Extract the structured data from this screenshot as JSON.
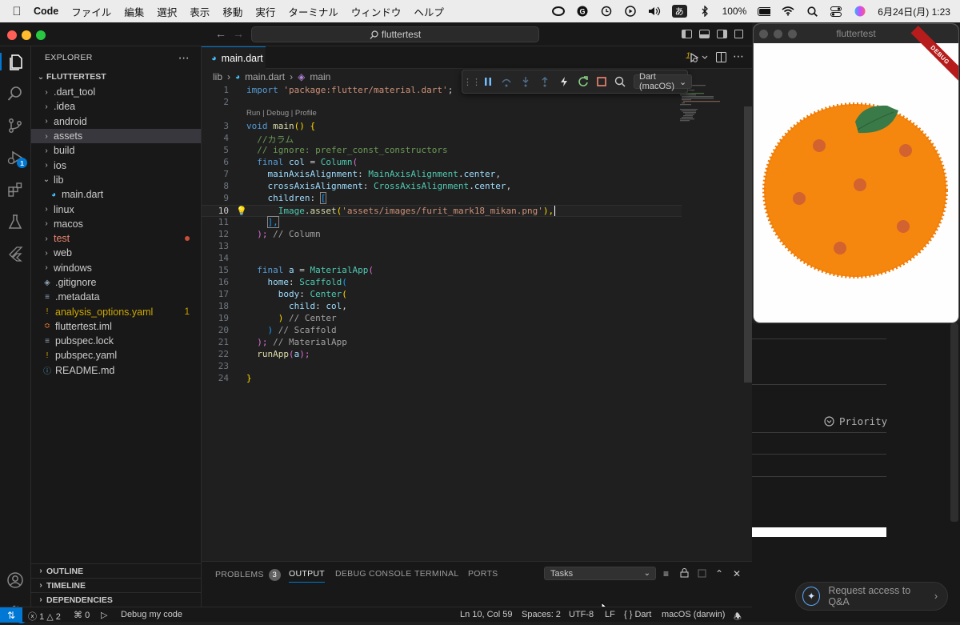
{
  "menubar": {
    "app_name": "Code",
    "menus": [
      "ファイル",
      "編集",
      "選択",
      "表示",
      "移動",
      "実行",
      "ターミナル",
      "ウィンドウ",
      "ヘルプ"
    ],
    "ime": "あ",
    "battery": "100%",
    "datetime": "6月24日(月)  1:23"
  },
  "titlebar": {
    "search": "fluttertest"
  },
  "activity": {
    "run_badge": "1",
    "settings_badge": "1"
  },
  "explorer": {
    "title": "EXPLORER",
    "root": "FLUTTERTEST",
    "items": [
      {
        "label": ".dart_tool",
        "type": "folder"
      },
      {
        "label": ".idea",
        "type": "folder"
      },
      {
        "label": "android",
        "type": "folder"
      },
      {
        "label": "assets",
        "type": "folder"
      },
      {
        "label": "build",
        "type": "folder"
      },
      {
        "label": "ios",
        "type": "folder"
      },
      {
        "label": "lib",
        "type": "folder-open"
      },
      {
        "label": "main.dart",
        "type": "dart"
      },
      {
        "label": "linux",
        "type": "folder"
      },
      {
        "label": "macos",
        "type": "folder"
      },
      {
        "label": "test",
        "type": "folder"
      },
      {
        "label": "web",
        "type": "folder"
      },
      {
        "label": "windows",
        "type": "folder"
      },
      {
        "label": ".gitignore",
        "type": "git"
      },
      {
        "label": ".metadata",
        "type": "file"
      },
      {
        "label": "analysis_options.yaml",
        "type": "yaml",
        "count": "1"
      },
      {
        "label": "fluttertest.iml",
        "type": "rss"
      },
      {
        "label": "pubspec.lock",
        "type": "file"
      },
      {
        "label": "pubspec.yaml",
        "type": "yaml"
      },
      {
        "label": "README.md",
        "type": "info"
      }
    ],
    "outline": "OUTLINE",
    "timeline": "TIMELINE",
    "dependencies": "DEPENDENCIES"
  },
  "editor": {
    "tab": "main.dart",
    "debug_target": "Dart (macOS)",
    "breadcrumb": {
      "folder": "lib",
      "file": "main.dart",
      "symbol": "main"
    },
    "code_lens": "Run | Debug | Profile",
    "line_numbers": [
      "1",
      "2",
      "",
      "3",
      "4",
      "5",
      "6",
      "7",
      "8",
      "9",
      "10",
      "11",
      "12",
      "13",
      "14",
      "15",
      "16",
      "17",
      "18",
      "19",
      "20",
      "21",
      "22",
      "23",
      "24"
    ],
    "lines": {
      "l1_kw": "import",
      "l1_str": "'package:flutter/material.dart'",
      "l1_end": ";",
      "l3_kw": "void",
      "l3_fn": "main",
      "l3_rest": "() {",
      "l4": "//カラム",
      "l5": "// ignore: prefer_const_constructors",
      "l6_kw": "final",
      "l6_var": "col",
      "l6_eq": " = ",
      "l6_cls": "Column",
      "l6_p": "(",
      "l7_prop": "mainAxisAlignment",
      "l7_cls": "MainAxisAlignment",
      "l7_dot": ".",
      "l7_val": "center",
      "l7_end": ",",
      "l8_prop": "crossAxisAlignment",
      "l8_cls": "CrossAxisAlignment",
      "l8_dot": ".",
      "l8_val": "center",
      "l8_end": ",",
      "l9_prop": "children",
      "l9_p": ": ",
      "l9_br": "[",
      "l10_cls": "Image",
      "l10_fn": "asset",
      "l10_str": "'assets/images/furit_mark18_mikan.png'",
      "l10_end": "),",
      "l11": "],",
      "l12": ");",
      "l12_cm": " // Column",
      "l15_kw": "final",
      "l15_var": "a",
      "l15_cls": "MaterialApp",
      "l16_prop": "home",
      "l16_cls": "Scaffold",
      "l17_prop": "body",
      "l17_cls": "Center",
      "l18_prop": "child",
      "l18_var": "col",
      "l19": ")",
      "l19_cm": " // Center",
      "l20": ")",
      "l20_cm": " // Scaffold",
      "l21": ");",
      "l21_cm": " // MaterialApp",
      "l22_fn": "runApp",
      "l22_var": "a",
      "l22_end": ");",
      "l24": "}"
    }
  },
  "panel": {
    "tabs": [
      "PROBLEMS",
      "OUTPUT",
      "DEBUG CONSOLE",
      "TERMINAL",
      "PORTS"
    ],
    "problems_count": "3",
    "active_tab": "OUTPUT",
    "tasks_select": "Tasks"
  },
  "statusbar": {
    "errors": "1",
    "warnings": "2",
    "ports": "0",
    "debug": "Debug my code",
    "position": "Ln 10, Col 59",
    "spaces": "Spaces: 2",
    "encoding": "UTF-8",
    "eol": "LF",
    "language": "Dart",
    "device": "macOS (darwin)"
  },
  "flutter_window": {
    "title": "fluttertest",
    "banner": "DEBUG"
  },
  "background_page": {
    "priority": "Priority",
    "qa_button": "Request access to Q&A"
  },
  "colors": {
    "accent": "#0078d4",
    "orange": "#f5870f",
    "leaf": "#3a7a48"
  }
}
